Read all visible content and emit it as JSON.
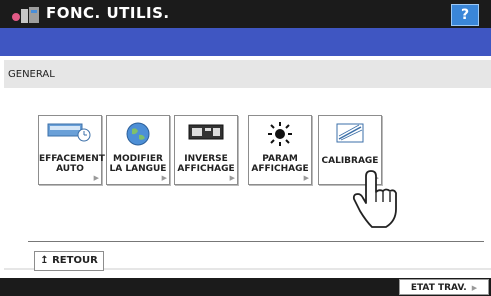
{
  "header": {
    "title": "FONC. UTILIS.",
    "help_label": "?",
    "app_icon": "user-functions-icon"
  },
  "section": {
    "label": "GENERAL"
  },
  "buttons": [
    {
      "line1": "EFFACEMENT",
      "line2": "AUTO",
      "icon": "auto-clear-icon"
    },
    {
      "line1": "MODIFIER",
      "line2": "LA LANGUE",
      "icon": "globe-icon"
    },
    {
      "line1": "INVERSE",
      "line2": "AFFICHAGE",
      "icon": "display-inverse-icon"
    },
    {
      "line1": "PARAM",
      "line2": "AFFICHAGE",
      "icon": "brightness-icon"
    },
    {
      "line1": "CALIBRAGE",
      "line2": "",
      "icon": "calibration-icon"
    }
  ],
  "back": {
    "label": "RETOUR"
  },
  "footer": {
    "status_label": "ETAT TRAV."
  },
  "colors": {
    "titlebar": "#1b1b1b",
    "bluebar": "#3f56c2",
    "help": "#3a86d8"
  }
}
